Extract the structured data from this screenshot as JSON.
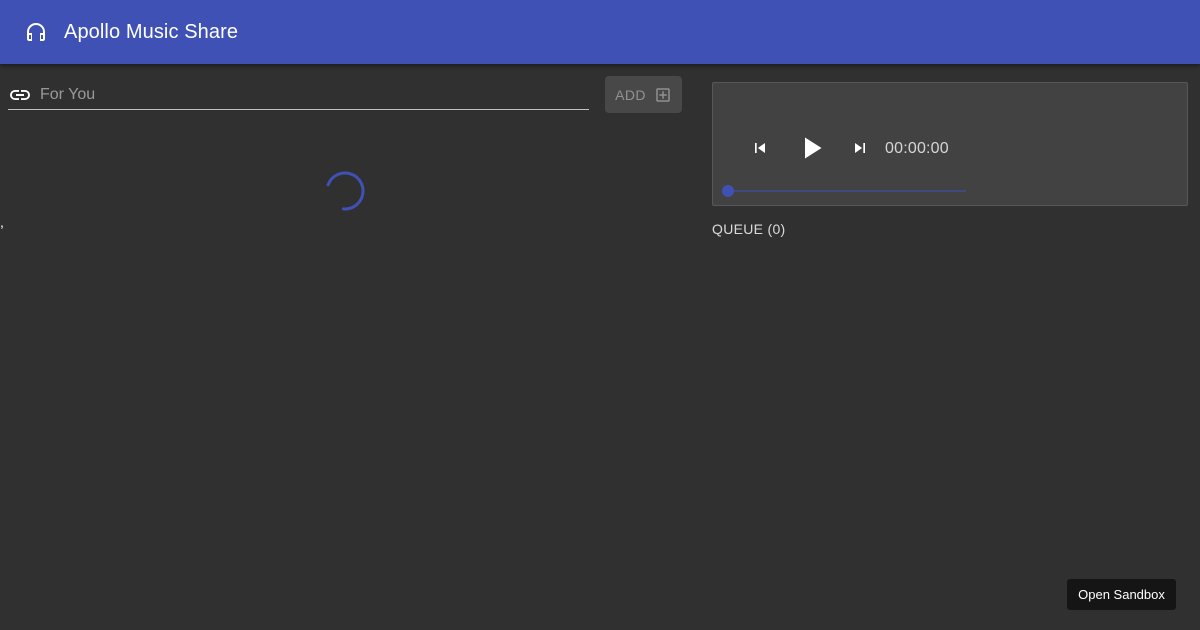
{
  "appbar": {
    "title": "Apollo Music Share",
    "logo_icon": "headphones-icon",
    "background": "#3f51b5"
  },
  "add_song": {
    "url_icon": "link-icon",
    "input_value": "",
    "input_placeholder": "For You",
    "add_label": "ADD",
    "add_icon": "add-box-icon"
  },
  "song_list": {
    "loading": true,
    "stray_text": ","
  },
  "player": {
    "prev_icon": "skip-previous-icon",
    "play_icon": "play-icon",
    "next_icon": "skip-next-icon",
    "time": "00:00:00",
    "progress": 0,
    "accent": "#3f51b5"
  },
  "queue": {
    "label": "QUEUE (0)"
  },
  "footer": {
    "sandbox_label": "Open Sandbox"
  }
}
